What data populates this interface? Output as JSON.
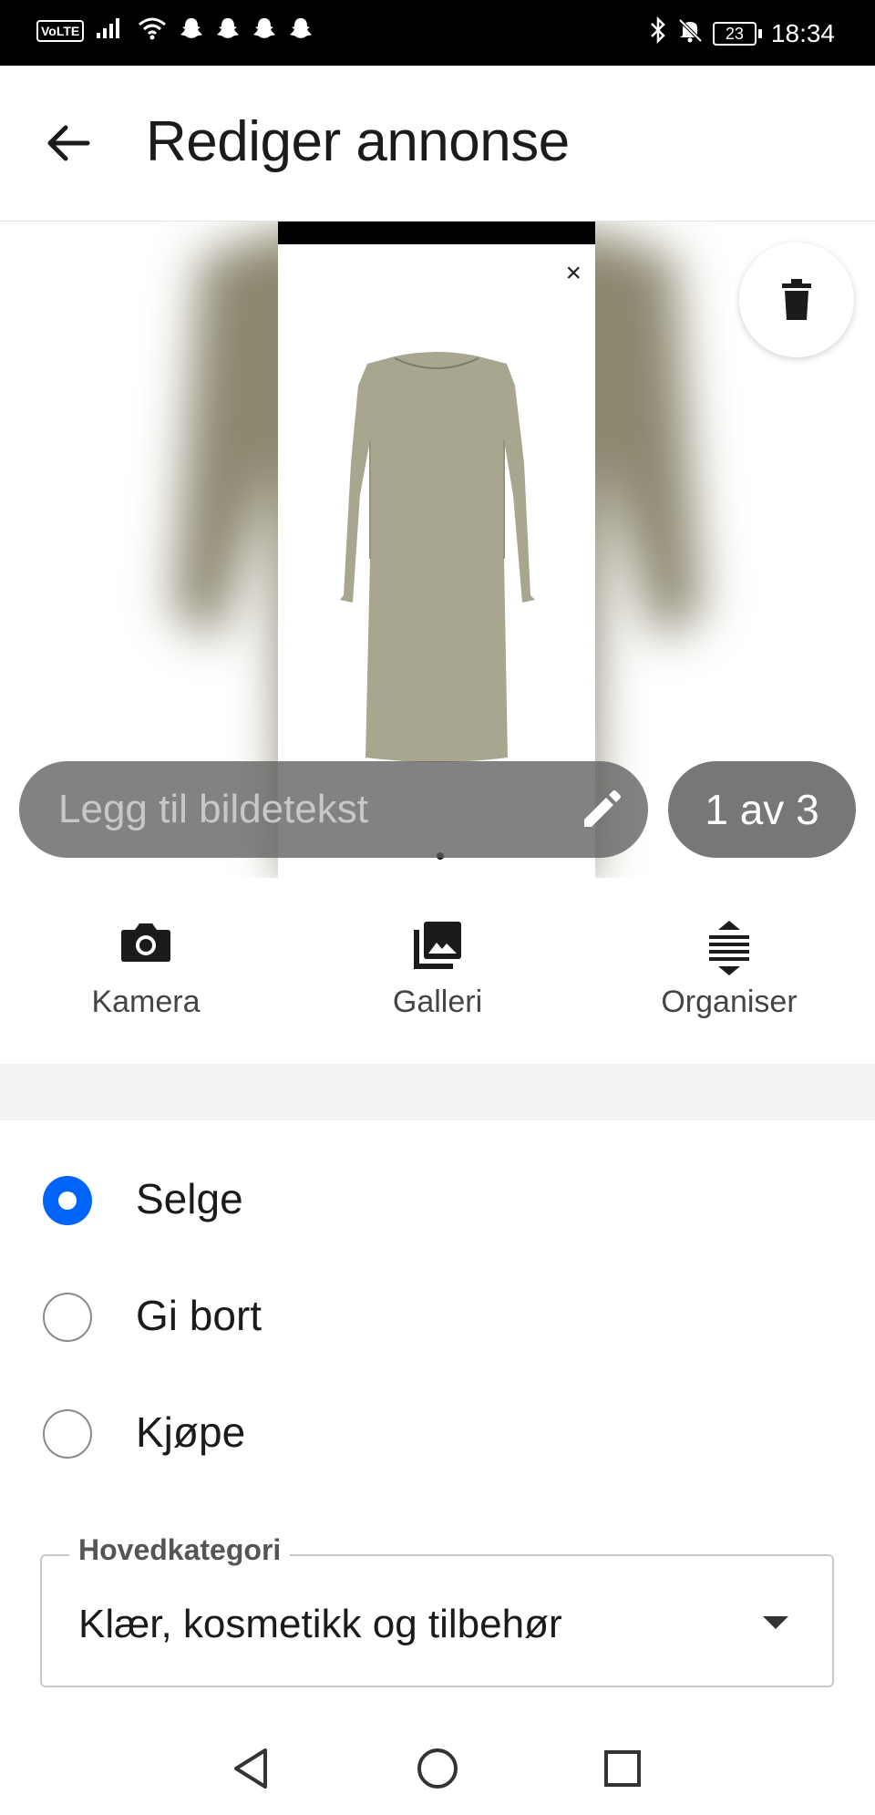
{
  "status_bar": {
    "network_badge": "VoLTE",
    "battery": "23",
    "time": "18:34",
    "icons": [
      "signal-icon",
      "wifi-icon",
      "snapchat-icon",
      "snapchat-icon",
      "snapchat-icon",
      "snapchat-icon",
      "bluetooth-icon",
      "mute-bell-icon",
      "battery-icon"
    ]
  },
  "header": {
    "title": "Rediger annonse",
    "back_icon": "arrow-left-icon"
  },
  "image_viewer": {
    "caption_placeholder": "Legg til bildetekst",
    "counter": "1 av 3",
    "delete_icon": "trash-icon",
    "edit_icon": "pencil-icon",
    "close_glyph": "×",
    "image_subject": "long-sleeve-dress",
    "dress_color": "#a8a68f"
  },
  "media_buttons": [
    {
      "label": "Kamera",
      "icon": "camera-icon"
    },
    {
      "label": "Galleri",
      "icon": "gallery-icon"
    },
    {
      "label": "Organiser",
      "icon": "reorder-icon"
    }
  ],
  "listing_type": {
    "options": [
      {
        "label": "Selge",
        "checked": true
      },
      {
        "label": "Gi bort",
        "checked": false
      },
      {
        "label": "Kjøpe",
        "checked": false
      }
    ],
    "accent_color": "#0063fb"
  },
  "category": {
    "legend": "Hovedkategori",
    "value": "Klær, kosmetikk og tilbehør"
  },
  "nav_bar": {
    "icons": [
      "nav-back-icon",
      "nav-home-icon",
      "nav-recents-icon"
    ]
  }
}
